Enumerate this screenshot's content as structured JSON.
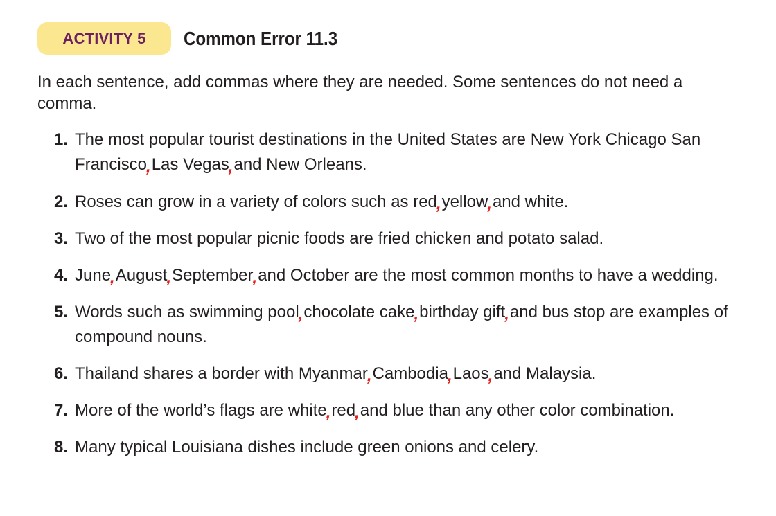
{
  "header": {
    "badge": "ACTIVITY 5",
    "title": "Common Error 11.3"
  },
  "instructions": "In each sentence, add commas where they are needed. Some sentences do not need a comma.",
  "comma_mark": ",",
  "colors": {
    "badge_bg": "#fbe78f",
    "badge_text": "#6e2160",
    "comma_red": "#e3201b"
  },
  "items": [
    {
      "num": "1.",
      "segments": [
        "The most popular tourist destinations in the United States are New York Chicago San Francisco",
        "Las Vegas",
        "and New Orleans."
      ]
    },
    {
      "num": "2.",
      "segments": [
        "Roses can grow in a variety of colors such as red",
        "yellow",
        "and white."
      ]
    },
    {
      "num": "3.",
      "segments": [
        "Two of the most popular picnic foods are fried chicken and potato salad."
      ]
    },
    {
      "num": "4.",
      "segments": [
        "June",
        "August",
        "September",
        "and October are the most common months to have a wedding."
      ]
    },
    {
      "num": "5.",
      "segments": [
        "Words such as swimming pool",
        "chocolate cake",
        "birthday gift",
        "and bus stop are examples of compound nouns."
      ]
    },
    {
      "num": "6.",
      "segments": [
        "Thailand shares a border with Myanmar",
        "Cambodia",
        "Laos",
        "and Malaysia."
      ]
    },
    {
      "num": "7.",
      "segments": [
        "More of the world’s flags are white",
        "red",
        "and blue than any other color combination."
      ]
    },
    {
      "num": "8.",
      "segments": [
        "Many typical Louisiana dishes include green onions and celery."
      ]
    }
  ]
}
